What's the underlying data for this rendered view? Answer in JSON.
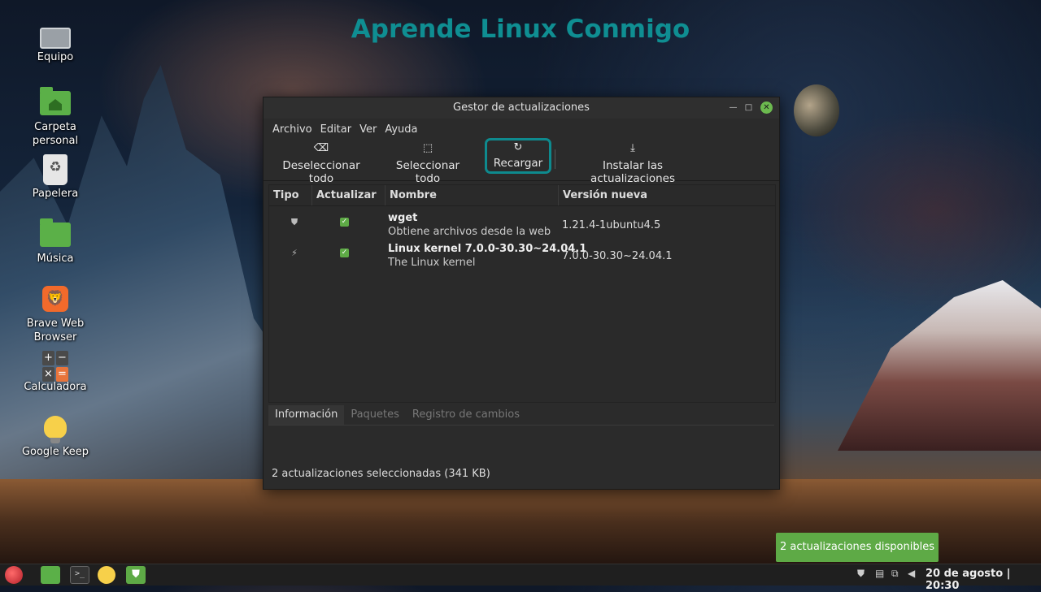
{
  "watermark": "Aprende Linux Conmigo",
  "desktop": {
    "icons": [
      {
        "label": "Equipo"
      },
      {
        "label": "Carpeta personal"
      },
      {
        "label": "Papelera"
      },
      {
        "label": "Música"
      },
      {
        "label": "Brave Web Browser"
      },
      {
        "label": "Calculadora"
      },
      {
        "label": "Google Keep"
      }
    ]
  },
  "window": {
    "title": "Gestor de actualizaciones",
    "menu": [
      "Archivo",
      "Editar",
      "Ver",
      "Ayuda"
    ],
    "toolbar": {
      "deselect_all": "Deseleccionar todo",
      "select_all": "Seleccionar todo",
      "reload": "Recargar",
      "install": "Instalar las actualizaciones"
    },
    "columns": [
      "Tipo",
      "Actualizar",
      "Nombre",
      "Versión nueva"
    ],
    "rows": [
      {
        "type_icon": "shield-icon",
        "checked": true,
        "name": "wget",
        "description": "Obtiene archivos desde la web",
        "version": "1.21.4-1ubuntu4.5"
      },
      {
        "type_icon": "lightning-icon",
        "checked": true,
        "name": "Linux kernel 7.0.0-30.30~24.04.1",
        "description": "The Linux kernel",
        "version": "7.0.0-30.30~24.04.1"
      }
    ],
    "tabs": [
      "Información",
      "Paquetes",
      "Registro de cambios"
    ],
    "active_tab": "Información",
    "status": "2 actualizaciones seleccionadas (341 KB)"
  },
  "notification": "2 actualizaciones disponibles",
  "taskbar": {
    "clock": "20 de agosto | 20:30"
  },
  "colors": {
    "accent_green": "#5eaa46",
    "highlight_teal": "#0e8a8e"
  }
}
